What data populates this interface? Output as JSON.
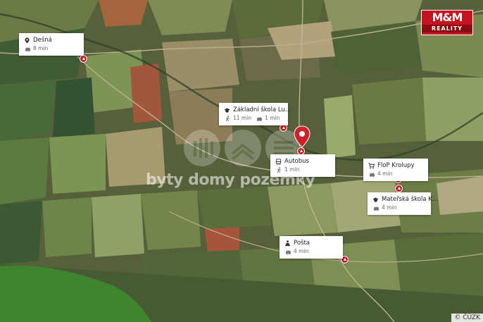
{
  "brand": {
    "logo_top": "M&M",
    "logo_bottom": "REALITY"
  },
  "watermark": {
    "text": "byty domy pozemky"
  },
  "attribution": "© ČÚZK",
  "colors": {
    "accent": "#c5141e",
    "pin": "#d0202a"
  },
  "pois": [
    {
      "icon": "location-icon",
      "name": "Dešná",
      "mode": "car",
      "time": "8 min"
    },
    {
      "icon": "school-icon",
      "name": "Základní škola Lu...",
      "walk_time": "11 min",
      "car_time": "1 min"
    },
    {
      "icon": "bus-icon",
      "name": "Autobus",
      "mode": "walk",
      "time": "1 min"
    },
    {
      "icon": "shop-icon",
      "name": "FloP Krolupy",
      "mode": "car",
      "time": "4 min"
    },
    {
      "icon": "school-icon",
      "name": "Mateřská škola K...",
      "mode": "car",
      "time": "4 min"
    },
    {
      "icon": "post-icon",
      "name": "Pošta",
      "mode": "car",
      "time": "4 min"
    }
  ]
}
